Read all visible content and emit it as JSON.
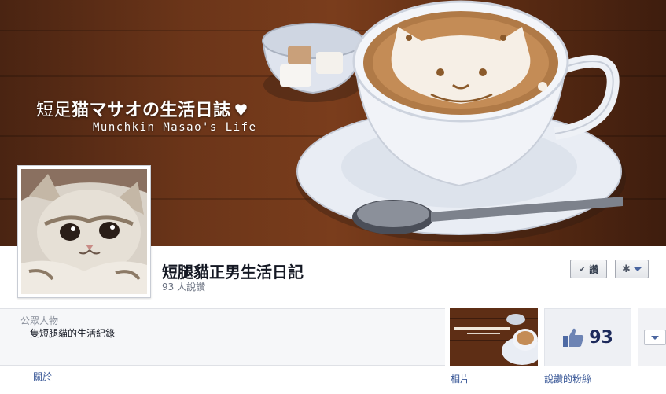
{
  "cover": {
    "title_prefix": "短足",
    "title_main": "猫マサオの生活日誌",
    "heart": "♥",
    "subtitle": "Munchkin Masao's Life"
  },
  "page": {
    "name": "短腿貓正男生活日記",
    "likes_text": "93 人說讚"
  },
  "actions": {
    "like_label": "讚",
    "check_icon": "✔",
    "gear_icon": "✱"
  },
  "about": {
    "category": "公眾人物",
    "description": "一隻短腿貓的生活紀錄",
    "link": "關於"
  },
  "apps": {
    "photos_label": "相片",
    "likes_label": "說讚的粉絲",
    "likes_count": "93"
  },
  "colors": {
    "link": "#3b5998",
    "wood": "#6b3519",
    "likes_count": "#1d2a5b"
  }
}
